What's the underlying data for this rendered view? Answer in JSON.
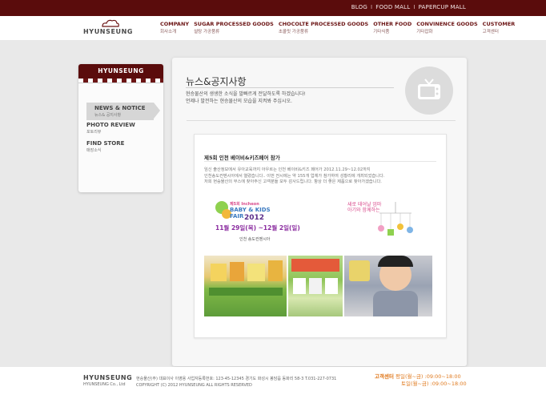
{
  "toplinks": {
    "blog": "BLOG",
    "sep1": "I",
    "foodmall": "FOOD MALL",
    "sep2": "I",
    "papercup": "PAPERCUP MALL"
  },
  "header": {
    "logo": "HYUNSEUNG",
    "menu": [
      {
        "en": "COMPANY",
        "ko": "회사소개"
      },
      {
        "en": "SUGAR PROCESSED GOODS",
        "ko": "설탕 가공품류"
      },
      {
        "en": "CHOCOLTE PROCESSED GOODS",
        "ko": "초콜릿 가공품류"
      },
      {
        "en": "OTHER FOOD",
        "ko": "기타식품"
      },
      {
        "en": "CONVINENCE GOODS",
        "ko": "기타잡화"
      },
      {
        "en": "CUSTOMER",
        "ko": "고객센터"
      }
    ]
  },
  "sidebar": {
    "title": "HYUNSEUNG",
    "items": [
      {
        "en": "NEWS & NOTICE",
        "ko": "뉴스& 공지사항"
      },
      {
        "en": "PHOTO REVIEW",
        "ko": "포토리뷰"
      },
      {
        "en": "FIND STORE",
        "ko": "매장소식"
      }
    ]
  },
  "main": {
    "title": "뉴스&공지사항",
    "intro1": "현승물산의 생생한 소식을 발빠르게 전달하도록 하겠습니다!",
    "intro2": "언제나 발전하는 현승물산의 모습을 지켜봐 주십시오."
  },
  "news": {
    "title": "제5회 인천 베이비&키즈페어 참가",
    "body1": "임신 출산정보에서 유아교육까지 아우르는 인천 베이비&키즈 페어가 2012.11.29~12.02까지",
    "body2": "인천송도컨벤시아에서 열렸습니다.. 이번 전시에는 약 155개 업체가 참가하여 성황리에 개최되었습니다.",
    "body3": "저희 현승물산의 부스에 찾아주신 고객분들 모두 감사드립니다. 항상 더 좋은 제품으로 찾아가겠습니다."
  },
  "banner": {
    "line1": "제5회 Incheon",
    "line2": "BABY & KIDS FAIR",
    "line3": "2012",
    "dates": "11월 29일(목) ~12월 2일(일)",
    "venue": "인천 송도컨벤시아",
    "mobile_text1": "새로 태어날 엄마",
    "mobile_text2": "아기와 함께하는"
  },
  "footer": {
    "logo": "HYUNSEUNG",
    "logo_sub": "HYUNSEUNG Co., Ltd",
    "address1": "현승물산(주)  대표이사 이영용  사업자등록번호: 123-45-12345  경기도 화성시 봉담읍 동화리 58-3 T.031-227-0731",
    "address2": "COPYRIGHT (C) 2012 HYUNSEUNG ALL RIGHTS RESERVED",
    "hours_label": "고객센터",
    "hours1": "평일(월~금) :09:00~18:00",
    "hours2": "토일(월~금) :09:00~18:00"
  }
}
